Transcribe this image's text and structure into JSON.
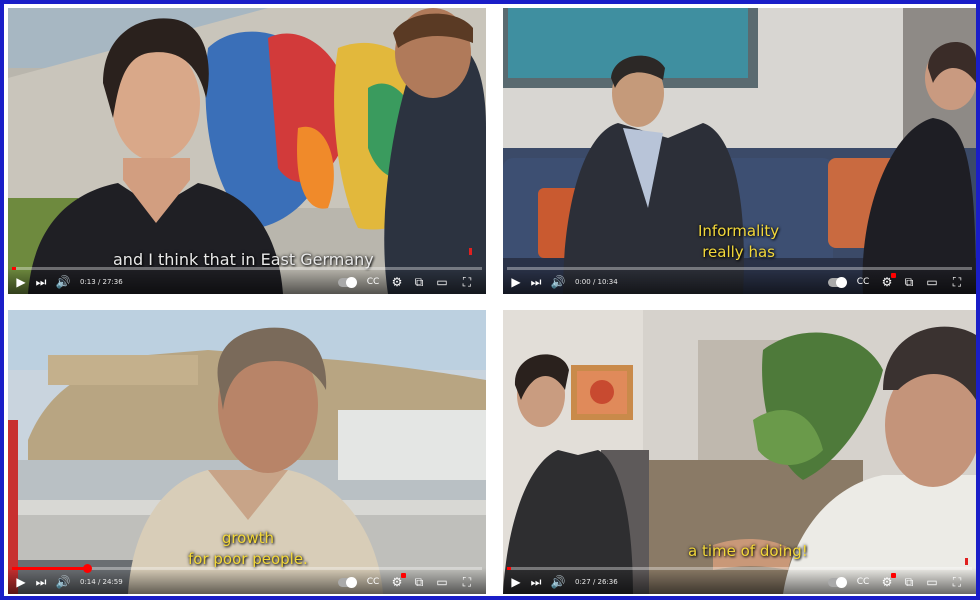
{
  "players": [
    {
      "id": "p1",
      "subtitle": "and I think that in East Germany",
      "subtitle_color": "#e9e9e9",
      "time": "0:13 / 27:36",
      "progress": 0.008
    },
    {
      "id": "p2",
      "subtitle_lines": [
        "Informality",
        "really has"
      ],
      "subtitle_color": "#f3d83a",
      "time": "0:00 / 10:34",
      "progress": 0.0
    },
    {
      "id": "p3",
      "subtitle_lines": [
        "growth",
        "for poor people."
      ],
      "subtitle_color": "#f3d83a",
      "time": "0:14 / 24:59",
      "progress": 0.16
    },
    {
      "id": "p4",
      "subtitle": "a time of doing!",
      "subtitle_color": "#f3d83a",
      "time": "0:27 / 26:36",
      "progress": 0.008
    }
  ],
  "controls": {
    "play_icon": "play-icon",
    "next_icon": "next-icon",
    "volume_icon": "volume-icon",
    "autoplay_icon": "autoplay-toggle-icon",
    "captions_icon": "captions-icon",
    "settings_icon": "settings-icon",
    "miniplayer_icon": "miniplayer-icon",
    "theater_icon": "theater-icon",
    "fullscreen_icon": "fullscreen-icon"
  },
  "colors": {
    "border": "#1a1ec8",
    "progress": "#ff0000",
    "subtitle_yellow": "#f3d83a"
  }
}
